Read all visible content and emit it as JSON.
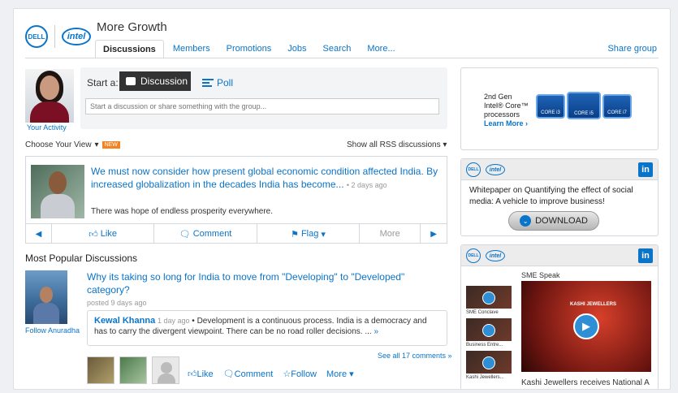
{
  "header": {
    "dell_logo": "DELL",
    "intel_logo": "intel",
    "group_title": "More Growth",
    "share_group": "Share group"
  },
  "tabs": [
    {
      "label": "Discussions",
      "active": true
    },
    {
      "label": "Members"
    },
    {
      "label": "Promotions"
    },
    {
      "label": "Jobs"
    },
    {
      "label": "Search"
    },
    {
      "label": "More..."
    }
  ],
  "composer": {
    "start_label": "Start a:",
    "discussion_label": "Discussion",
    "poll_label": "Poll",
    "input_placeholder": "Start a discussion or share something with the group...",
    "your_activity": "Your Activity"
  },
  "filters": {
    "choose_view": "Choose Your View",
    "new_badge": "NEW",
    "rss": "Show all RSS discussions"
  },
  "featured": {
    "title": "We must now consider how present global economic condition affected India. By increased globalization in the decades India has become...",
    "age": "2 days ago",
    "snippet": "There was hope of endless prosperity everywhere.",
    "like": "Like",
    "comment": "Comment",
    "flag": "Flag",
    "more": "More"
  },
  "popular": {
    "heading": "Most Popular Discussions",
    "follow": "Follow Anuradha",
    "title": "Why its taking so long for India to move from \"Developing\" to \"Developed\" category?",
    "posted": "posted 9 days ago",
    "comment_author": "Kewal Khanna",
    "comment_age": "1 day ago",
    "comment_text": "Development is a continuous process. India is a democracy and has to carry the divergent viewpoint. There can be no road roller decisions. ...",
    "comment_more": "»",
    "see_all": "See all 17 comments »",
    "like": "Like",
    "comment": "Comment",
    "follow_action": "Follow",
    "more": "More"
  },
  "ads": {
    "intel": {
      "line1": "2nd Gen",
      "line2": "Intel® Core™",
      "line3": "processors",
      "learn_more": "Learn More ›",
      "chip_labels": [
        "CORE i3",
        "CORE i5",
        "CORE i7"
      ]
    },
    "whitepaper": {
      "text": "Whitepaper on Quantifying the effect of social media: A vehicle to improve business!",
      "download": "DOWNLOAD",
      "linkedin": "in"
    },
    "sme": {
      "title": "SME Speak",
      "videos": [
        "SME Conclave",
        "Business Entre...",
        "Kashi Jewellers..."
      ],
      "main_tag": "KASHI JEWELLERS",
      "main_caption": "Kashi Jewellers receives National A"
    }
  },
  "colors": {
    "link": "#0a74c9",
    "badge": "#f58220"
  }
}
